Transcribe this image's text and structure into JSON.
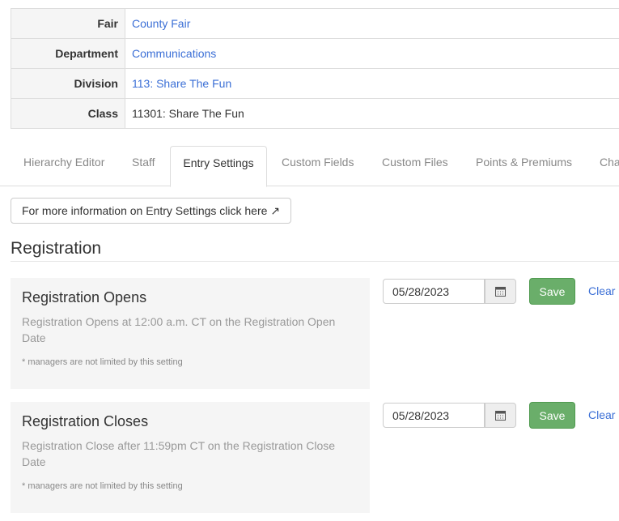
{
  "info_table": [
    {
      "label": "Fair",
      "value": "County Fair",
      "link": true
    },
    {
      "label": "Department",
      "value": "Communications",
      "link": true
    },
    {
      "label": "Division",
      "value": "113: Share The Fun",
      "link": true
    },
    {
      "label": "Class",
      "value": "11301: Share The Fun",
      "link": false
    }
  ],
  "tabs": [
    "Hierarchy Editor",
    "Staff",
    "Entry Settings",
    "Custom Fields",
    "Custom Files",
    "Points & Premiums",
    "Cha"
  ],
  "active_tab": "Entry Settings",
  "info_button": "For more information on Entry Settings click here",
  "section_title": "Registration",
  "settings": [
    {
      "title": "Registration Opens",
      "desc": "Registration Opens at 12:00 a.m. CT on the Registration Open Date",
      "note": "* managers are not limited by this setting",
      "date": "05/28/2023",
      "save": "Save",
      "clear": "Clear"
    },
    {
      "title": "Registration Closes",
      "desc": "Registration Close after 11:59pm CT on the Registration Close Date",
      "note": "* managers are not limited by this setting",
      "date": "05/28/2023",
      "save": "Save",
      "clear": "Clear"
    }
  ]
}
